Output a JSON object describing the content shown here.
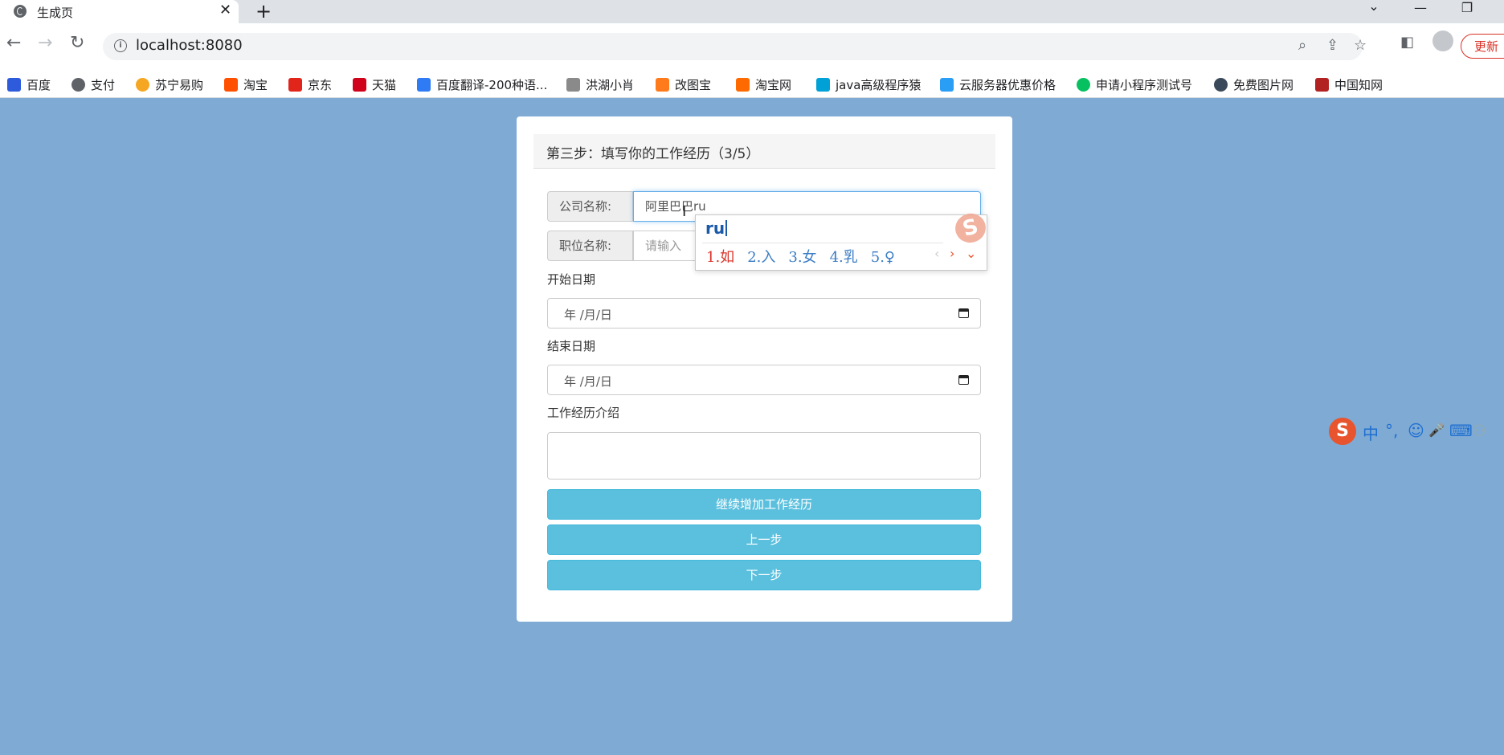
{
  "browser": {
    "tab_title": "生成页",
    "new_tab": "+",
    "url": "localhost:8080",
    "update_label": "更新",
    "bookmarks": [
      "百度",
      "支付",
      "苏宁易购",
      "淘宝",
      "京东",
      "天猫",
      "百度翻译-200种语...",
      "洪湖小肖",
      "改图宝",
      "淘宝网",
      "java高级程序猿",
      "云服务器优惠价格",
      "申请小程序测试号",
      "免费图片网",
      "中国知网"
    ]
  },
  "form": {
    "step_title": "第三步：填写你的工作经历（3/5）",
    "company_label": "公司名称:",
    "company_value": "阿里巴巴ru",
    "position_label": "职位名称:",
    "position_placeholder": "请输入",
    "start_date_label": "开始日期",
    "start_date_value": "年 /月/日",
    "end_date_label": "结束日期",
    "end_date_value": "年 /月/日",
    "description_label": "工作经历介绍",
    "add_button": "继续增加工作经历",
    "prev_button": "上一步",
    "next_button": "下一步"
  },
  "ime": {
    "composition": "ru",
    "candidates": [
      "1.如",
      "2.入",
      "3.女",
      "4.乳",
      "5.♀"
    ],
    "logo": "S",
    "toolbar": [
      "中",
      "°,",
      "☺",
      "🎤",
      "⌨"
    ]
  },
  "colors": {
    "page_bg": "#7eaad4",
    "button_bg": "#5bc0de",
    "ime_candidate_first": "#d9342b",
    "ime_candidate": "#3a7cc4"
  }
}
